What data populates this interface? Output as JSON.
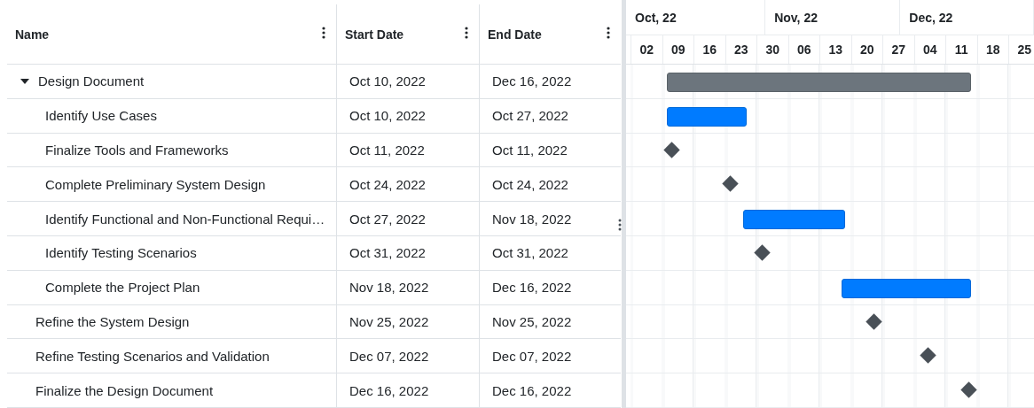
{
  "columns": [
    {
      "label": "Name"
    },
    {
      "label": "Start Date"
    },
    {
      "label": "End Date"
    }
  ],
  "timeline": {
    "months": [
      "Oct, 22",
      "Nov, 22",
      "Dec, 22"
    ],
    "weeks": [
      "02",
      "09",
      "16",
      "23",
      "30",
      "06",
      "13",
      "20",
      "27",
      "04",
      "11",
      "18",
      "25"
    ]
  },
  "tasks": [
    {
      "name": "Design Document",
      "start": "Oct 10, 2022",
      "end": "Dec 16, 2022",
      "kind": "summary",
      "expanded": true,
      "children": [
        {
          "name": "Identify Use Cases",
          "start": "Oct 10, 2022",
          "end": "Oct 27, 2022",
          "kind": "task"
        },
        {
          "name": "Finalize Tools and Frameworks",
          "start": "Oct 11, 2022",
          "end": "Oct 11, 2022",
          "kind": "milestone"
        },
        {
          "name": "Complete Preliminary System Design",
          "start": "Oct 24, 2022",
          "end": "Oct 24, 2022",
          "kind": "milestone"
        },
        {
          "name": "Identify Functional and Non-Functional Requi…",
          "start": "Oct 27, 2022",
          "end": "Nov 18, 2022",
          "kind": "task"
        },
        {
          "name": "Identify Testing Scenarios",
          "start": "Oct 31, 2022",
          "end": "Oct 31, 2022",
          "kind": "milestone"
        },
        {
          "name": "Complete the Project Plan",
          "start": "Nov 18, 2022",
          "end": "Dec 16, 2022",
          "kind": "task"
        }
      ]
    },
    {
      "name": "Refine the System Design",
      "start": "Nov 25, 2022",
      "end": "Nov 25, 2022",
      "kind": "milestone"
    },
    {
      "name": "Refine Testing Scenarios and Validation",
      "start": "Dec 07, 2022",
      "end": "Dec 07, 2022",
      "kind": "milestone"
    },
    {
      "name": "Finalize the Design Document",
      "start": "Dec 16, 2022",
      "end": "Dec 16, 2022",
      "kind": "milestone"
    }
  ]
}
